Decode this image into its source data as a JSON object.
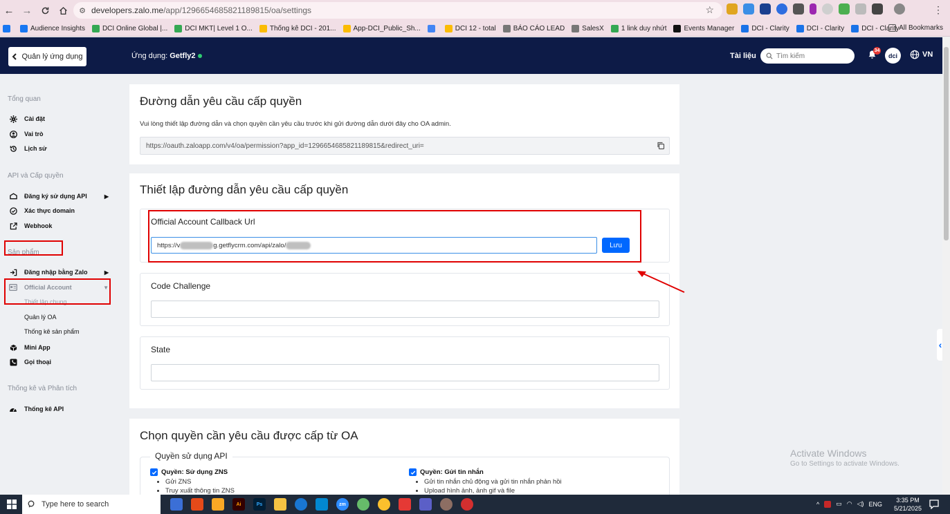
{
  "browser": {
    "url_host": "developers.zalo.me",
    "url_path": "/app/1296654685821189815/oa/settings",
    "bookmarks": [
      {
        "label": "",
        "color": "#1877f2"
      },
      {
        "label": "Audience Insights",
        "color": "#1877f2"
      },
      {
        "label": "DCI Online Global |...",
        "color": "#34a853"
      },
      {
        "label": "DCI MKT| Level 1 O...",
        "color": "#34a853"
      },
      {
        "label": "Thống kê DCI - 201...",
        "color": "#fbbc04"
      },
      {
        "label": "App-DCI_Public_Sh...",
        "color": "#fbbc04"
      },
      {
        "label": "",
        "color": "#4285f4"
      },
      {
        "label": "DCI 12 - total",
        "color": "#fbbc04"
      },
      {
        "label": "BÁO CÁO LEAD",
        "color": "#777777"
      },
      {
        "label": "SalesX",
        "color": "#777777"
      },
      {
        "label": "1 link duy nhứt",
        "color": "#34a853"
      },
      {
        "label": "Events Manager",
        "color": "#111111"
      },
      {
        "label": "DCI - Clarity",
        "color": "#1a73e8"
      },
      {
        "label": "DCI - Clarity",
        "color": "#1a73e8"
      },
      {
        "label": "DCI - Clarity",
        "color": "#1a73e8"
      }
    ],
    "all_bookmarks": "All Bookmarks"
  },
  "header": {
    "back_label": "Quản lý ứng dụng",
    "app_prefix": "Ứng dụng:",
    "app_name": "Getfly2",
    "docs": "Tài liệu",
    "search_placeholder": "Tìm kiếm",
    "notif_count": "34",
    "avatar_text": "dci",
    "lang": "VN"
  },
  "sidebar": {
    "overview": "Tổng quan",
    "settings": "Cài đặt",
    "roles": "Vai trò",
    "history": "Lịch sử",
    "api_section": "API và Cấp quyền",
    "register_api": "Đăng ký sử dụng API",
    "verify_domain": "Xác thực domain",
    "webhook": "Webhook",
    "products": "Sản phẩm",
    "zalo_login": "Đăng nhập bằng Zalo",
    "official_account": "Official Account",
    "general_settings": "Thiết lập chung",
    "manage_oa": "Quản lý OA",
    "product_stats": "Thống kê sản phẩm",
    "mini_app": "Mini App",
    "calls": "Gọi thoại",
    "analytics_section": "Thống kê và Phân tích",
    "api_stats": "Thống kê API"
  },
  "auth_link": {
    "title": "Đường dẫn yêu cầu cấp quyền",
    "desc": "Vui lòng thiết lập đường dẫn và chọn quyền cần yêu cầu trước khi gửi đường dẫn dưới đây cho OA admin.",
    "url": "https://oauth.zaloapp.com/v4/oa/permission?app_id=1296654685821189815&redirect_uri="
  },
  "setup": {
    "title": "Thiết lập đường dẫn yêu cầu cấp quyền",
    "callback_label": "Official Account Callback Url",
    "callback_prefix": "https://v",
    "callback_mid": "g.getflycrm.com/api/zalo/",
    "save": "Lưu",
    "code_challenge_label": "Code Challenge",
    "state_label": "State"
  },
  "permissions": {
    "title": "Chọn quyền cần yêu cầu được cấp từ OA",
    "group": "Quyền sử dụng API",
    "zns": {
      "title": "Quyền: Sử dụng ZNS",
      "items": [
        "Gửi ZNS",
        "Truy xuất thông tin ZNS"
      ]
    },
    "msg": {
      "title": "Quyền: Gửi tin nhắn",
      "items": [
        "Gửi tin nhắn chủ động và gửi tin nhắn phản hồi",
        "Upload hình ảnh, ảnh gif và file"
      ]
    }
  },
  "watermark": {
    "line1": "Activate Windows",
    "line2": "Go to Settings to activate Windows."
  },
  "taskbar": {
    "search": "Type here to search",
    "lang": "ENG",
    "time": "3:35 PM",
    "date": "5/21/2025",
    "notif_count": "2"
  }
}
